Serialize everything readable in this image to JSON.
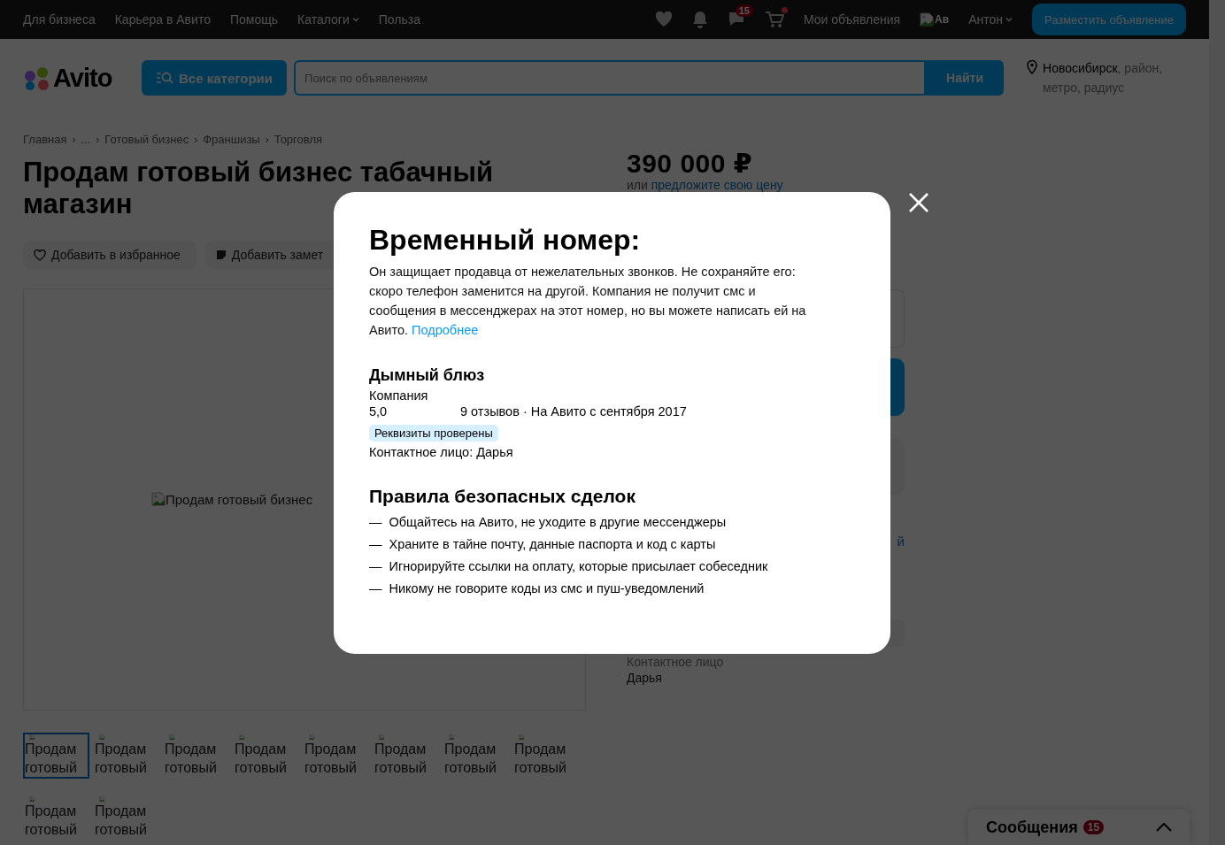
{
  "top_nav": {
    "links": [
      {
        "label": "Для бизнеса",
        "dropdown": false
      },
      {
        "label": "Карьера в Авито",
        "dropdown": false
      },
      {
        "label": "Помощь",
        "dropdown": false
      },
      {
        "label": "Каталоги",
        "dropdown": true
      },
      {
        "label": "Польза",
        "dropdown": false
      }
    ],
    "messages_badge": "15",
    "cart_dot": true,
    "my_ads": "Мои объявления",
    "avatar_alt": "Ав",
    "user": "Антон",
    "post_button": "Разместить объявление"
  },
  "header": {
    "logo": "Avito",
    "categories_button": "Все категории",
    "search_placeholder": "Поиск по объявлениям",
    "search_button": "Найти",
    "city": "Новосибирск",
    "location_hint": ", район, метро, радиус"
  },
  "breadcrumb_separator": "›",
  "breadcrumbs": [
    "Главная",
    "...",
    "Готовый бизнес",
    "Франшизы",
    "Торговля"
  ],
  "listing": {
    "title": "Продам готовый бизнес табачный магазин",
    "actions": [
      "Добавить в избранное",
      "Добавить замет"
    ],
    "image_alt": "Продам готовый бизнес",
    "thumbnails": [
      {
        "alt": "Продам готовый",
        "selected": true
      },
      {
        "alt": "Продам готовый",
        "selected": false
      },
      {
        "alt": "Продам готовый",
        "selected": false
      },
      {
        "alt": "Продам готовый",
        "selected": false
      },
      {
        "alt": "Продам готовый",
        "selected": false
      },
      {
        "alt": "Продам готовый",
        "selected": false
      },
      {
        "alt": "Продам готовый",
        "selected": false
      },
      {
        "alt": "Продам готовый",
        "selected": false
      },
      {
        "alt": "Продам готовый",
        "selected": false
      },
      {
        "alt": "Продам готовый",
        "selected": false
      }
    ]
  },
  "sidebar": {
    "price": "390 000 ₽",
    "price_hint": "или",
    "price_link": "предложите свою цену",
    "link_fragment": "й",
    "contact_label": "Контактное лицо",
    "contact_name": "Дарья"
  },
  "messenger": {
    "title": "Сообщения",
    "badge": "15"
  },
  "modal": {
    "title": "Временный номер:",
    "text": "Он защищает продавца от нежелательных звонков. Не сохраняйте его: скоро телефон заменится на другой. Компания не получит смс и сообщения в мессенджерах на этот номер, но вы можете написать ей на Авито.",
    "link": "Подробнее",
    "seller": {
      "name": "Дымный блюз",
      "type": "Компания",
      "rating": "5,0",
      "reviews": "9 отзывов · На Авито с сентября 2017",
      "badge": "Реквизиты проверены",
      "contact": "Контактное лицо: Дарья"
    },
    "rules_title": "Правила безопасных сделок",
    "rule_mark": "—",
    "rules": [
      "Общайтесь на Авито, не уходите в другие мессенджеры",
      "Храните в тайне почту, данные паспорта и код с карты",
      "Игнорируйте ссылки на оплату, которые присылает собеседник",
      "Никому не говорите коды из смс и пуш-уведомлений"
    ]
  }
}
